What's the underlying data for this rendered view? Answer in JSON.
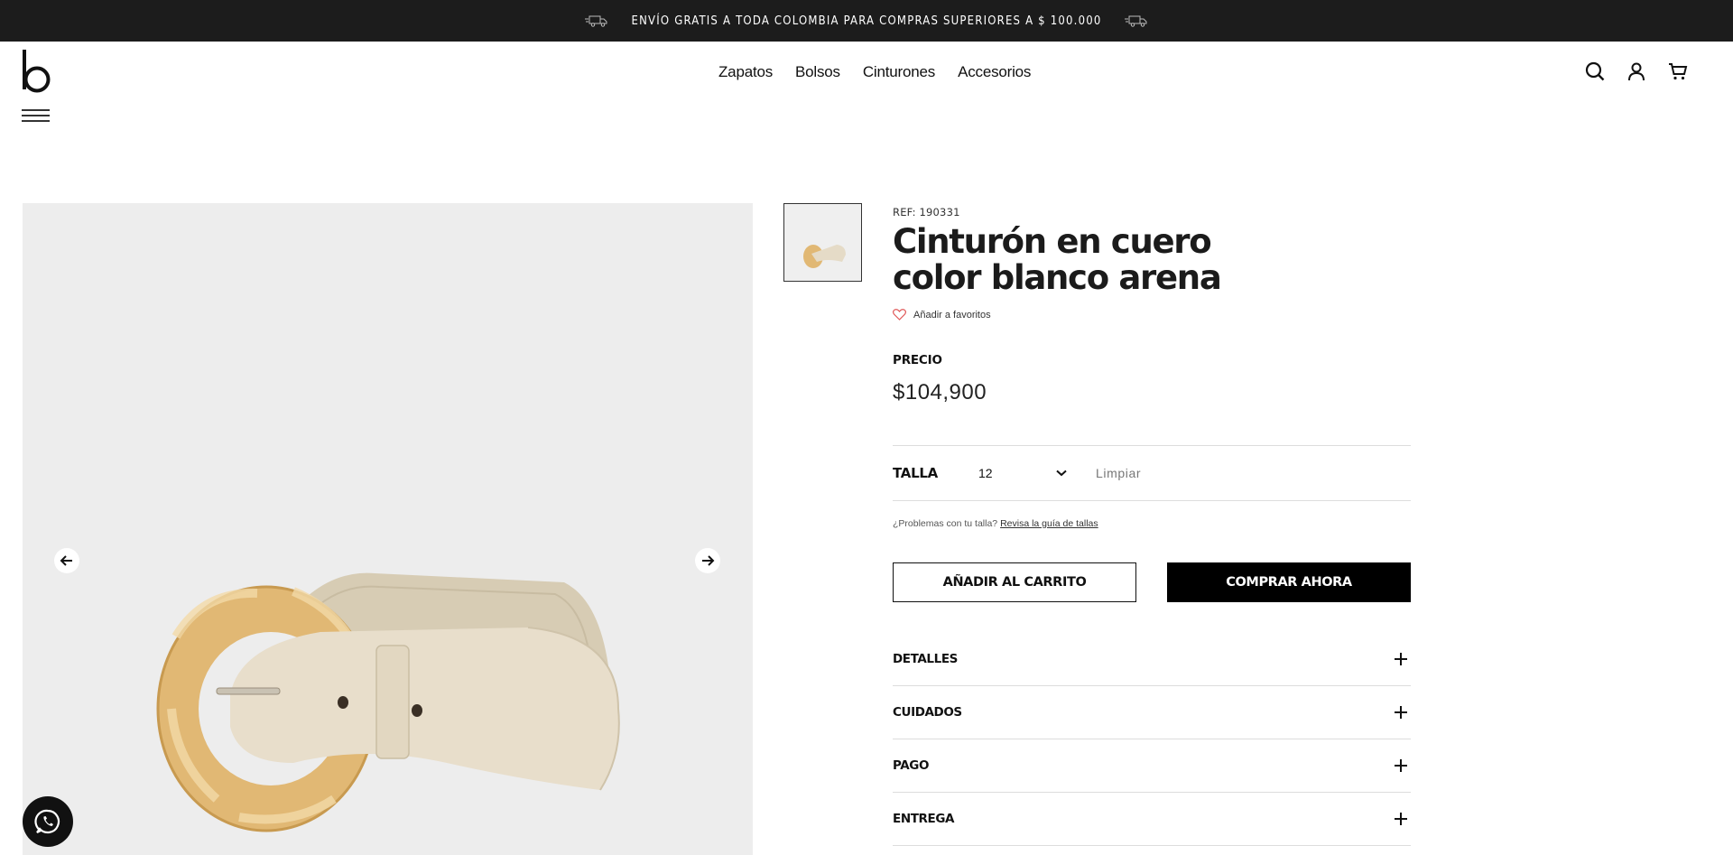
{
  "announcement": {
    "text": "ENVÍO GRATIS A TODA COLOMBIA PARA COMPRAS SUPERIORES A $ 100.000",
    "icon": "truck-icon"
  },
  "header": {
    "logo_icon": "brand-logo",
    "nav": [
      "Zapatos",
      "Bolsos",
      "Cinturones",
      "Accesorios"
    ],
    "icons": [
      "search-icon",
      "user-icon",
      "cart-icon"
    ]
  },
  "gallery": {
    "prev_icon": "arrow-left-icon",
    "next_icon": "arrow-right-icon",
    "whatsapp_icon": "whatsapp-icon"
  },
  "product": {
    "ref": "REF: 190331",
    "title": "Cinturón en cuero color blanco arena",
    "favorite": "Añadir a favoritos",
    "price_label": "PRECIO",
    "price": "$104,900",
    "size_label": "TALLA",
    "size_value": "12",
    "clear": "Limpiar",
    "size_help_text": "¿Problemas con tu talla?",
    "size_help_link": "Revisa la guía de tallas",
    "add_to_cart": "AÑADIR AL CARRITO",
    "buy_now": "COMPRAR AHORA",
    "accordions": [
      "DETALLES",
      "CUIDADOS",
      "PAGO",
      "ENTREGA"
    ]
  },
  "colors": {
    "topbar": "#1c1c1c",
    "gallery_bg": "#ededed",
    "favorite_heart": "#e05a5a",
    "belt_leather": "#e6dcc6",
    "buckle": "#d9b070"
  }
}
